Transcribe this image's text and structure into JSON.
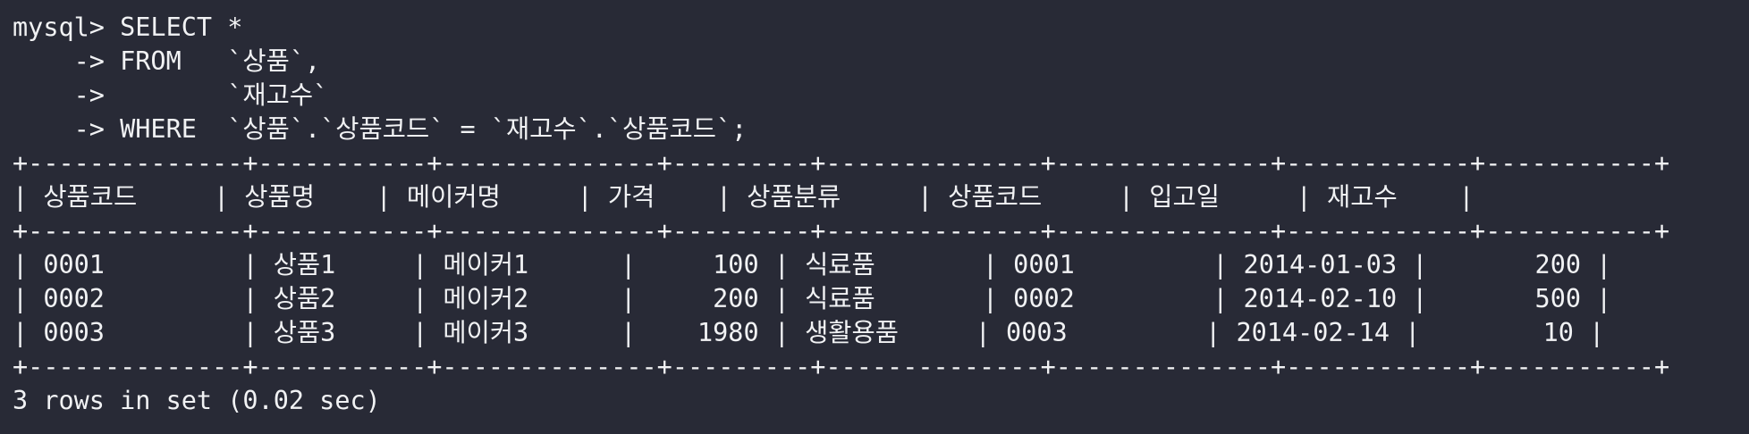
{
  "terminal": {
    "lines": [
      "mysql> SELECT *",
      "    -> FROM   `상품`,",
      "    ->        `재고수`",
      "    -> WHERE  `상품`.`상품코드` = `재고수`.`상품코드`;",
      "+--------------+-----------+--------------+---------+--------------+--------------+------------+-----------+",
      "| 상품코드     | 상품명    | 메이커명     | 가격    | 상품분류     | 상품코드     | 입고일     | 재고수    |",
      "+--------------+-----------+--------------+---------+--------------+--------------+------------+-----------+",
      "| 0001         | 상품1     | 메이커1      |     100 | 식료품       | 0001         | 2014-01-03 |       200 |",
      "| 0002         | 상품2     | 메이커2      |     200 | 식료품       | 0002         | 2014-02-10 |       500 |",
      "| 0003         | 상품3     | 메이커3      |    1980 | 생활용품     | 0003         | 2014-02-14 |        10 |",
      "+--------------+-----------+--------------+---------+--------------+--------------+------------+-----------+",
      "3 rows in set (0.02 sec)"
    ]
  }
}
